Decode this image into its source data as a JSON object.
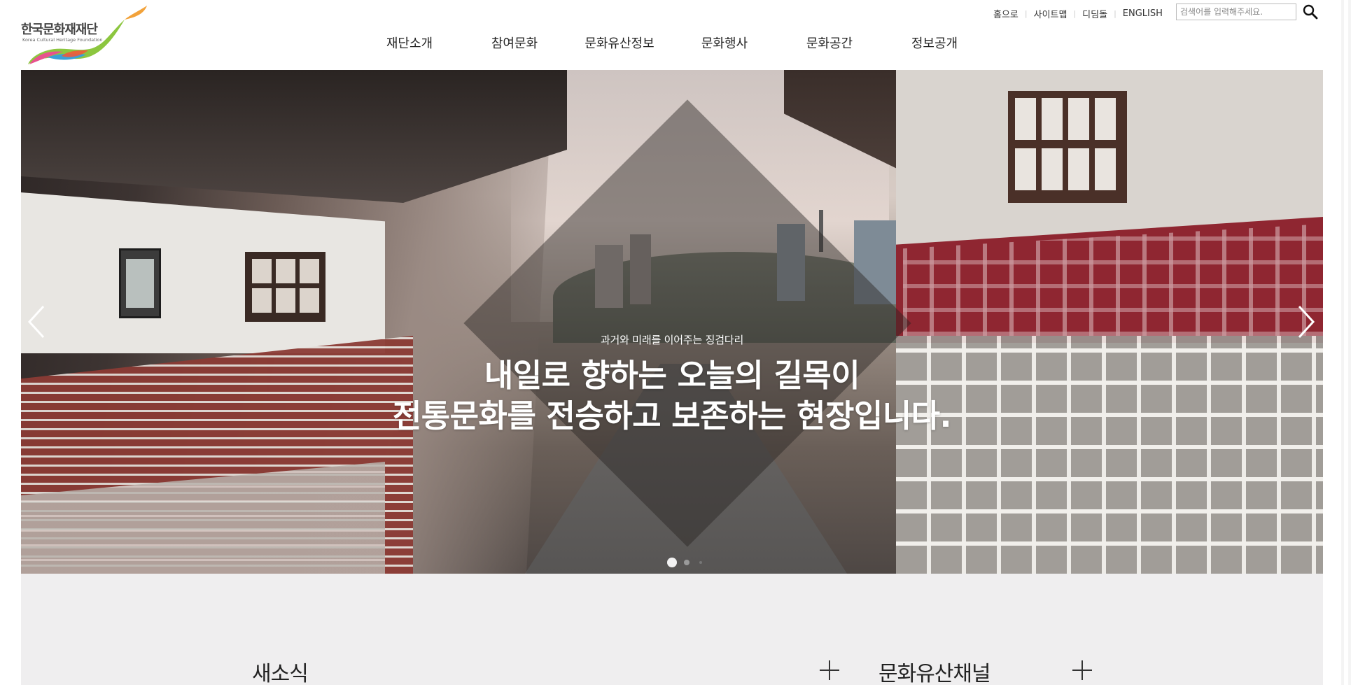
{
  "logo": {
    "name_ko": "한국문화재재단",
    "name_en": "Korea Cultural Heritage Foundation"
  },
  "util_links": [
    {
      "label": "홈으로"
    },
    {
      "label": "사이트맵"
    },
    {
      "label": "디딤돌"
    },
    {
      "label": "ENGLISH"
    }
  ],
  "search": {
    "placeholder": "검색어를 입력해주세요.",
    "icon": "search-icon"
  },
  "gnb": [
    {
      "label": "재단소개"
    },
    {
      "label": "참여문화"
    },
    {
      "label": "문화유산정보"
    },
    {
      "label": "문화행사"
    },
    {
      "label": "문화공간"
    },
    {
      "label": "정보공개"
    }
  ],
  "hero": {
    "subtitle": "과거와 미래를 이어주는 징검다리",
    "title_line1": "내일로 향하는 오늘의 길목이",
    "title_line2": "전통문화를 전승하고 보존하는 현장입니다.",
    "prev_icon": "chevron-left-icon",
    "next_icon": "chevron-right-icon",
    "slides_total": 3,
    "active_slide": 1
  },
  "sections": {
    "news_title": "새소식",
    "channel_title": "문화유산채널",
    "more_icon": "plus-icon"
  },
  "colors": {
    "overlay": "#28242273",
    "text_white": "#ffffff",
    "lower_bg": "#efeeef"
  }
}
